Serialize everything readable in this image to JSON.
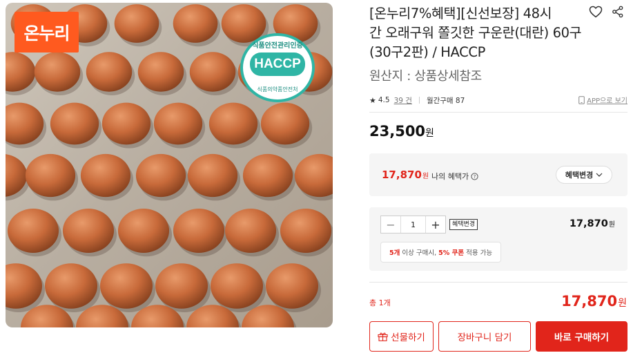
{
  "product_image": {
    "logo_text": "온누리",
    "haccp_top": "식품안전관리인증",
    "haccp_main": "HACCP",
    "haccp_bottom": "식품의약품안전처",
    "brand_color": "#ff5a1f",
    "haccp_color": "#2fb5a5"
  },
  "product": {
    "title_line1": "[온누리7%혜택][신선보장] 48시",
    "title_line2": "간 오래구워 쫄깃한 구운란(대란) 60구",
    "title_line3": "(30구2판) / HACCP",
    "origin": "원산지 : 상품상세참조",
    "icons": [
      "heart-icon",
      "share-icon"
    ]
  },
  "rating": {
    "star": "★",
    "score": "4.5",
    "review_count": "39 건",
    "monthly_sales": "월간구매 87",
    "app_view": "APP으로 보기"
  },
  "price": {
    "value": "23,500",
    "unit": "원"
  },
  "benefit": {
    "price": "17,870",
    "unit": "원",
    "label": "나의 혜택가",
    "change_button": "혜택변경"
  },
  "option": {
    "minus": "−",
    "quantity": "1",
    "plus": "+",
    "small_change": "혜택변경",
    "price": "17,870",
    "unit": "원",
    "tip_part1": "5개",
    "tip_part2": " 이상 구매시, ",
    "tip_part3": "5% 쿠폰",
    "tip_part4": " 적용 가능"
  },
  "total": {
    "label": "총 1개",
    "price": "17,870",
    "unit": "원"
  },
  "buttons": {
    "gift": "선물하기",
    "cart": "장바구니 담기",
    "buy": "바로 구매하기"
  },
  "colors": {
    "accent_red": "#e1251b"
  }
}
